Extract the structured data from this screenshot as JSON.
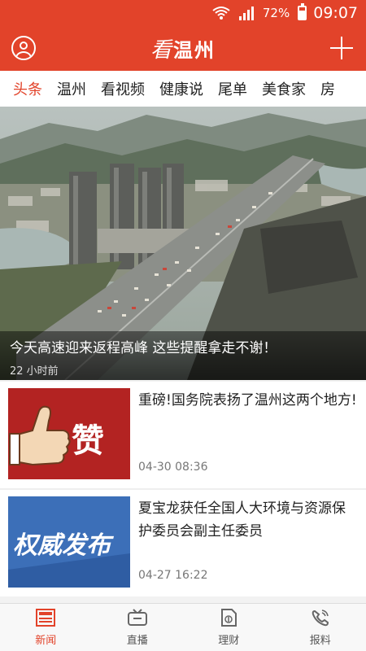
{
  "status_bar": {
    "battery_percent": "72%",
    "battery_level": 0.72,
    "time": "09:07",
    "icons": [
      "wifi-icon",
      "signal-icon",
      "battery-icon"
    ]
  },
  "header": {
    "logo_script": "看",
    "logo_city": "温州",
    "left_icon": "user-icon",
    "right_icon": "plus-icon"
  },
  "tabs": [
    {
      "label": "头条",
      "active": true
    },
    {
      "label": "温州"
    },
    {
      "label": "看视频"
    },
    {
      "label": "健康说"
    },
    {
      "label": "尾单"
    },
    {
      "label": "美食家"
    },
    {
      "label": "房"
    }
  ],
  "hero": {
    "title": "今天高速迎来返程高峰 这些提醒拿走不谢！",
    "time": "22 小时前"
  },
  "news": [
    {
      "headline": "重磅!国务院表扬了温州这两个地方!",
      "date": "04-30 08:36",
      "thumb_text": "赞"
    },
    {
      "headline": "夏宝龙获任全国人大环境与资源保护委员会副主任委员",
      "date": "04-27 16:22",
      "thumb_text": "权威发布"
    }
  ],
  "bottom_nav": [
    {
      "label": "新闻",
      "icon": "news-icon",
      "active": true
    },
    {
      "label": "直播",
      "icon": "live-tv-icon"
    },
    {
      "label": "理财",
      "icon": "finance-icon"
    },
    {
      "label": "报料",
      "icon": "report-phone-icon"
    }
  ],
  "colors": {
    "brand_red": "#e2432a",
    "thumb_red": "#b32322",
    "thumb_blue": "#3c6fb8"
  }
}
